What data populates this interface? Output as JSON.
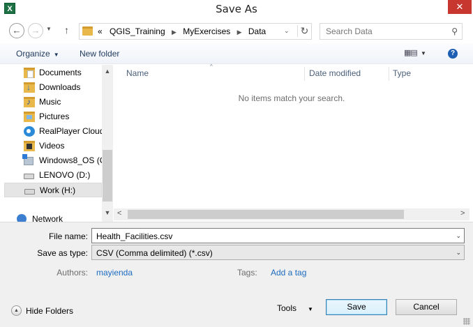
{
  "window": {
    "title": "Save As",
    "app_icon_label": "X",
    "close_glyph": "✕"
  },
  "nav": {
    "back_glyph": "←",
    "forward_glyph": "→",
    "recent_glyph": "▼",
    "up_glyph": "↑"
  },
  "address": {
    "overflow": "«",
    "crumbs": [
      "QGIS_Training",
      "MyExercises",
      "Data"
    ],
    "sep_glyph": "▶",
    "dropdown_glyph": "⌄",
    "refresh_glyph": "↻"
  },
  "search": {
    "placeholder": "Search Data",
    "icon_glyph": "⚲"
  },
  "toolbar": {
    "organize_label": "Organize",
    "caret_glyph": "▼",
    "new_folder_label": "New folder",
    "views_glyph": "▦▤",
    "help_glyph": "?"
  },
  "sidebar": {
    "items": [
      {
        "label": "Documents",
        "icon": "documents-icon"
      },
      {
        "label": "Downloads",
        "icon": "downloads-icon"
      },
      {
        "label": "Music",
        "icon": "music-icon"
      },
      {
        "label": "Pictures",
        "icon": "pictures-icon"
      },
      {
        "label": "RealPlayer Cloud",
        "icon": "realplayer-cloud-icon"
      },
      {
        "label": "Videos",
        "icon": "videos-icon"
      },
      {
        "label": "Windows8_OS (C",
        "icon": "windows-drive-icon"
      },
      {
        "label": "LENOVO (D:)",
        "icon": "drive-icon"
      },
      {
        "label": "Work (H:)",
        "icon": "drive-icon",
        "selected": true
      },
      {
        "label": "Network",
        "icon": "network-icon"
      }
    ],
    "scroll_up_glyph": "▲",
    "scroll_down_glyph": "▼"
  },
  "content": {
    "columns": [
      "Name",
      "Date modified",
      "Type"
    ],
    "sort_glyph": "^",
    "empty_message": "No items match your search.",
    "scroll_left_glyph": "<",
    "scroll_right_glyph": ">"
  },
  "form": {
    "file_name_label": "File name:",
    "file_name_value": "Health_Facilities.csv",
    "save_type_label": "Save as type:",
    "save_type_value": "CSV (Comma delimited) (*.csv)",
    "dropdown_glyph": "⌄",
    "authors_label": "Authors:",
    "authors_value": "mayienda",
    "tags_label": "Tags:",
    "tags_value": "Add a tag"
  },
  "footer": {
    "hide_folders_label": "Hide Folders",
    "hide_glyph": "▲",
    "tools_label": "Tools",
    "caret_glyph": "▼",
    "save_label": "Save",
    "cancel_label": "Cancel"
  }
}
